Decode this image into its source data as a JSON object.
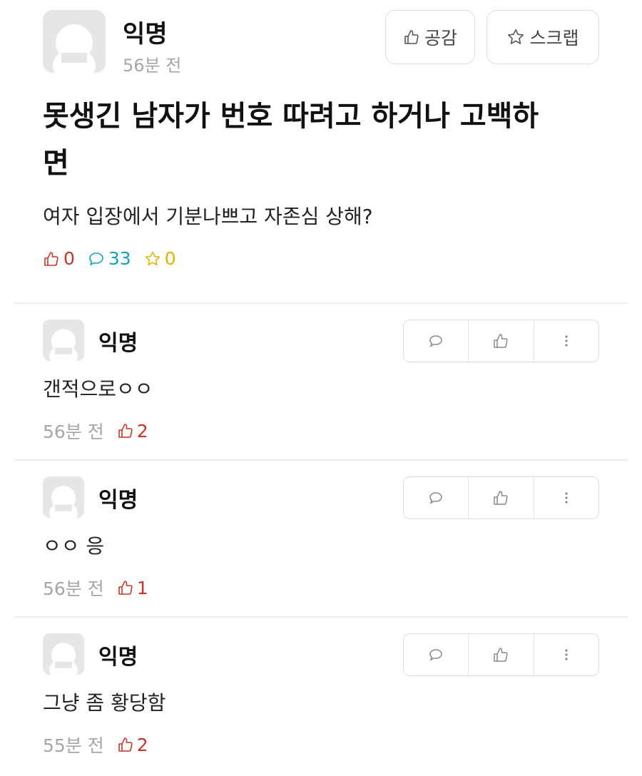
{
  "post": {
    "author": "익명",
    "time": "56분 전",
    "like_button_label": "공감",
    "scrap_button_label": "스크랩",
    "title": "못생긴 남자가 번호 따려고 하거나 고백하면",
    "body": "여자 입장에서 기분나쁘고 자존심 상해?",
    "stats": {
      "likes": "0",
      "comments": "33",
      "scraps": "0"
    }
  },
  "comments": [
    {
      "author": "익명",
      "text": "갠적으로ㅇㅇ",
      "time": "56분 전",
      "likes": "2"
    },
    {
      "author": "익명",
      "text": "ㅇㅇ 응",
      "time": "56분 전",
      "likes": "1"
    },
    {
      "author": "익명",
      "text": "그냥 좀 황당함",
      "time": "55분 전",
      "likes": "2"
    }
  ],
  "colors": {
    "like_red": "#c0392b",
    "comment_teal": "#17a2b8",
    "scrap_yellow": "#e0b400",
    "meta_gray": "#a6a6a6"
  },
  "icons": {
    "like": "thumbs-up-icon",
    "comment": "speech-bubble-icon",
    "scrap": "star-icon",
    "more": "more-vertical-icon",
    "avatar": "default-avatar-icon"
  }
}
